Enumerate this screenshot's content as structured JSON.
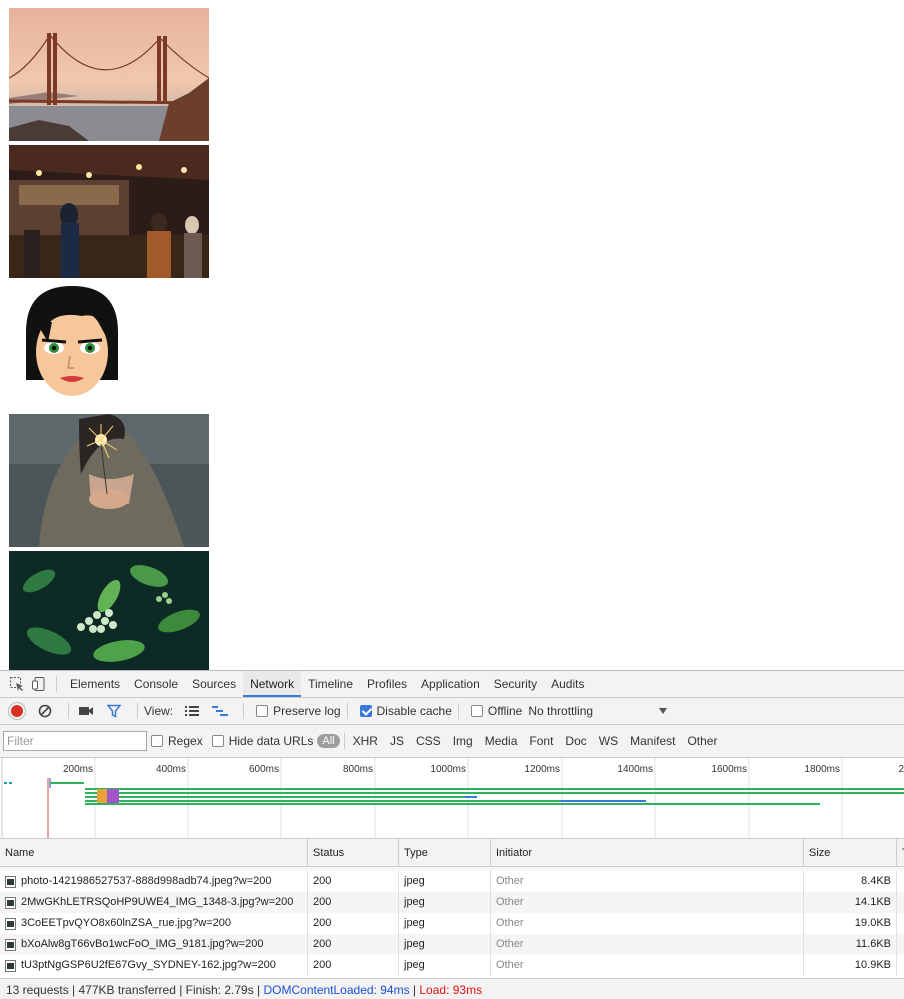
{
  "devtools": {
    "tabs": [
      {
        "label": "Elements"
      },
      {
        "label": "Console"
      },
      {
        "label": "Sources"
      },
      {
        "label": "Network"
      },
      {
        "label": "Timeline"
      },
      {
        "label": "Profiles"
      },
      {
        "label": "Application"
      },
      {
        "label": "Security"
      },
      {
        "label": "Audits"
      }
    ],
    "active_tab": "Network"
  },
  "toolbar": {
    "view_label": "View:",
    "preserve_log": {
      "label": "Preserve log",
      "checked": false
    },
    "disable_cache": {
      "label": "Disable cache",
      "checked": true
    },
    "offline": {
      "label": "Offline",
      "checked": false
    },
    "throttling": "No throttling"
  },
  "filter": {
    "placeholder": "Filter",
    "regex": {
      "label": "Regex",
      "checked": false
    },
    "hide_data_urls": {
      "label": "Hide data URLs",
      "checked": false
    },
    "types": [
      "All",
      "XHR",
      "JS",
      "CSS",
      "Img",
      "Media",
      "Font",
      "Doc",
      "WS",
      "Manifest",
      "Other"
    ]
  },
  "overview": {
    "ticks": [
      "200ms",
      "400ms",
      "600ms",
      "800ms",
      "1000ms",
      "1200ms",
      "1400ms",
      "1600ms",
      "1800ms",
      "2"
    ]
  },
  "grid": {
    "columns": [
      "Name",
      "Status",
      "Type",
      "Initiator",
      "Size",
      "T"
    ],
    "rows": [
      {
        "name": "photo-1421986527537-888d998adb74.jpeg?w=200",
        "status": "200",
        "type": "jpeg",
        "initiator": "Other",
        "size": "8.4KB"
      },
      {
        "name": "2MwGKhLETRSQoHP9UWE4_IMG_1348-3.jpg?w=200",
        "status": "200",
        "type": "jpeg",
        "initiator": "Other",
        "size": "14.1KB"
      },
      {
        "name": "3CoEETpvQYO8x60lnZSA_rue.jpg?w=200",
        "status": "200",
        "type": "jpeg",
        "initiator": "Other",
        "size": "19.0KB"
      },
      {
        "name": "bXoAlw8gT66vBo1wcFoO_IMG_9181.jpg?w=200",
        "status": "200",
        "type": "jpeg",
        "initiator": "Other",
        "size": "11.6KB"
      },
      {
        "name": "tU3ptNgGSP6U2fE67Gvy_SYDNEY-162.jpg?w=200",
        "status": "200",
        "type": "jpeg",
        "initiator": "Other",
        "size": "10.9KB"
      }
    ]
  },
  "status": {
    "summary": "13 requests | 477KB transferred | Finish: 2.79s | ",
    "dom_content_loaded": "DOMContentLoaded: 94ms",
    "separator": " | ",
    "load": "Load: 93ms"
  },
  "colors": {
    "accent": "#3879d9",
    "dcl_line": "#1a4fd6",
    "load_line": "#d11111"
  }
}
